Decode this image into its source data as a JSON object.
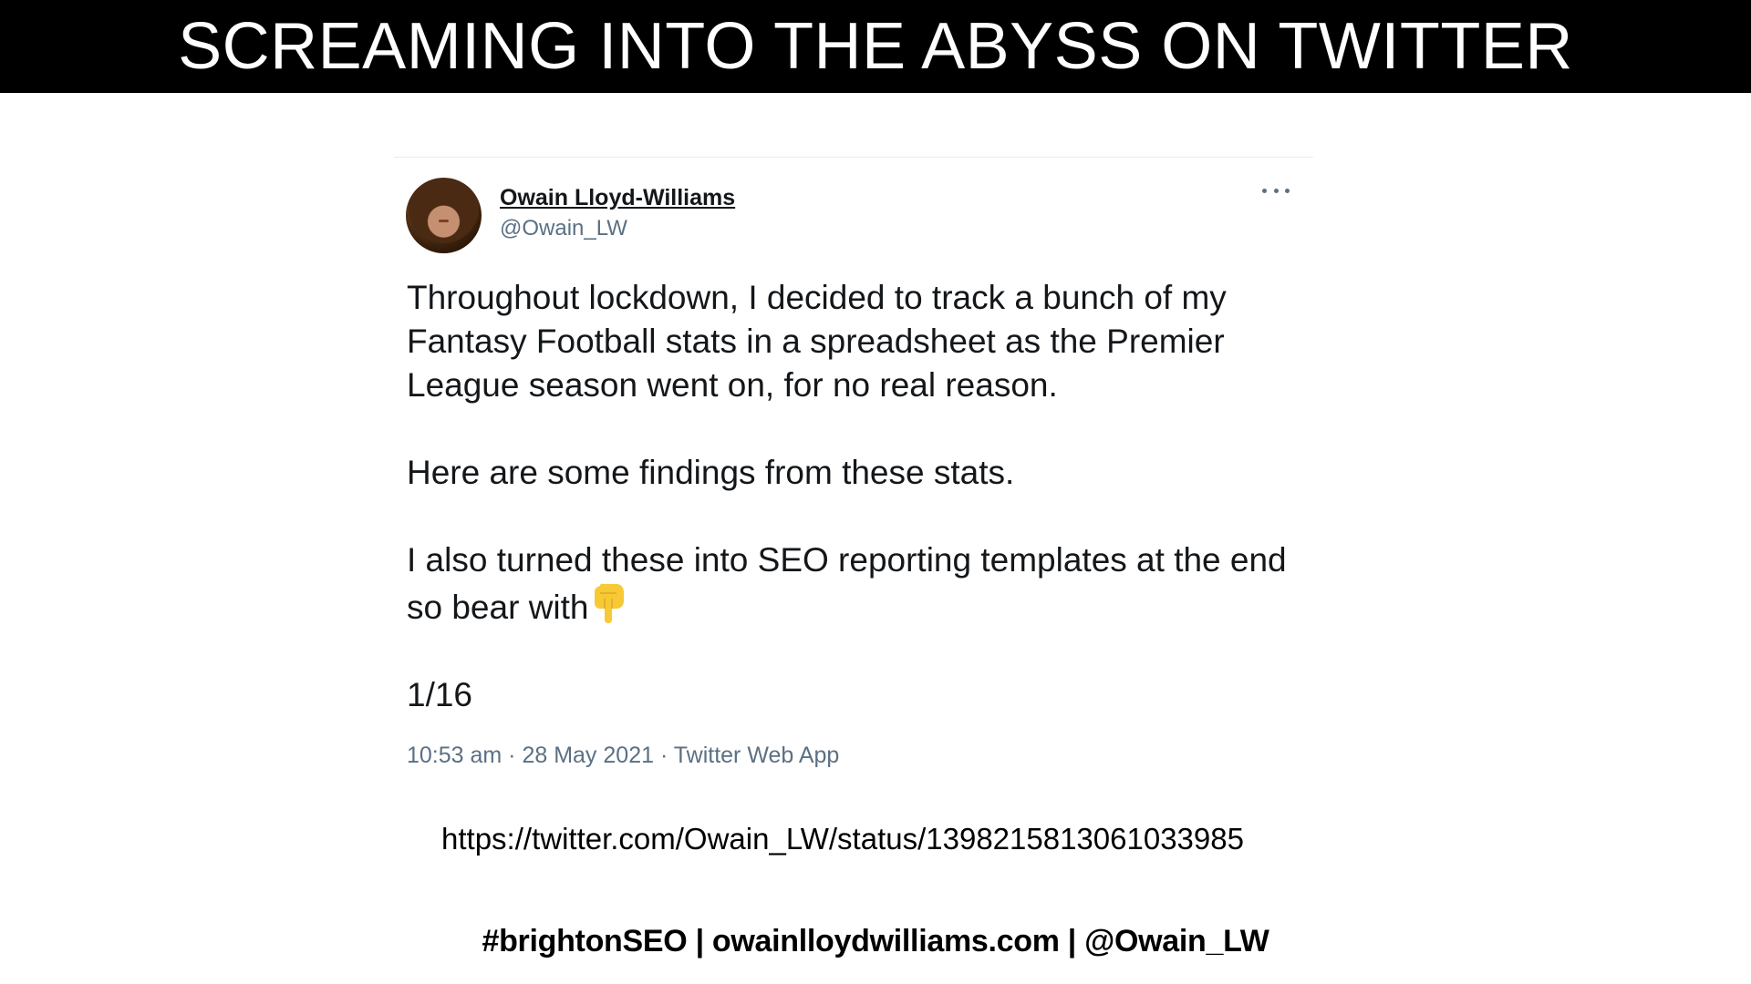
{
  "slide": {
    "title": "SCREAMING INTO THE ABYSS ON TWITTER",
    "footer": "#brightonSEO | owainlloydwilliams.com | @Owain_LW"
  },
  "tweet": {
    "author_name": "Owain Lloyd-Williams",
    "author_handle": "@Owain_LW",
    "paragraph_1": "Throughout lockdown, I decided to track a bunch of my Fantasy Football stats in a spreadsheet as the Premier League season went on, for no real reason.",
    "paragraph_2": "Here are some findings from these stats.",
    "paragraph_3": "I also turned these into SEO reporting templates at the end so bear with",
    "paragraph_3_icon": "pointing-down-icon",
    "paragraph_4": "1/16",
    "meta": "10:53 am · 28 May 2021 · Twitter Web App",
    "url": "https://twitter.com/Owain_LW/status/1398215813061033985"
  },
  "colors": {
    "title_bar": "#000000",
    "title_text": "#ffffff",
    "secondary_text": "#5b7083",
    "emoji": "#f7c934"
  }
}
